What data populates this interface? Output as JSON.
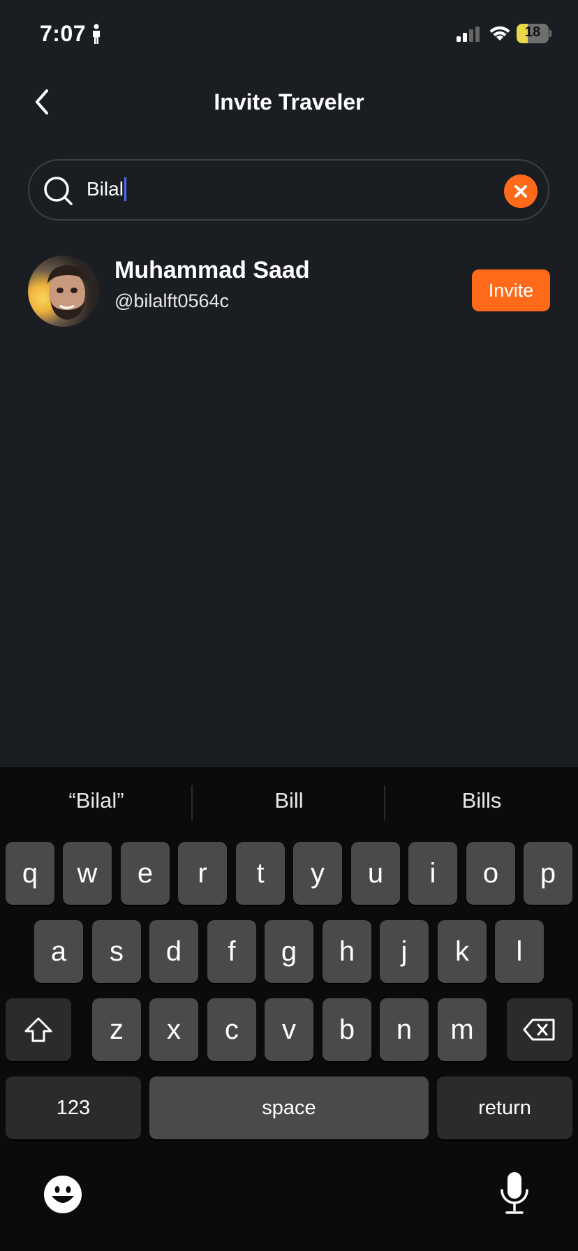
{
  "status_bar": {
    "time": "7:07",
    "battery": "18"
  },
  "header": {
    "title": "Invite Traveler"
  },
  "search": {
    "value": "Bilal"
  },
  "results": [
    {
      "name": "Muhammad Saad",
      "handle": "@bilalft0564c",
      "action": "Invite"
    }
  ],
  "keyboard": {
    "suggestions": [
      "“Bilal”",
      "Bill",
      "Bills"
    ],
    "row1": [
      "q",
      "w",
      "e",
      "r",
      "t",
      "y",
      "u",
      "i",
      "o",
      "p"
    ],
    "row2": [
      "a",
      "s",
      "d",
      "f",
      "g",
      "h",
      "j",
      "k",
      "l"
    ],
    "row3": [
      "z",
      "x",
      "c",
      "v",
      "b",
      "n",
      "m"
    ],
    "numbers_label": "123",
    "space_label": "space",
    "return_label": "return"
  },
  "colors": {
    "accent": "#ff6a1a",
    "background": "#1a1d21",
    "caret": "#4a6cf7"
  }
}
